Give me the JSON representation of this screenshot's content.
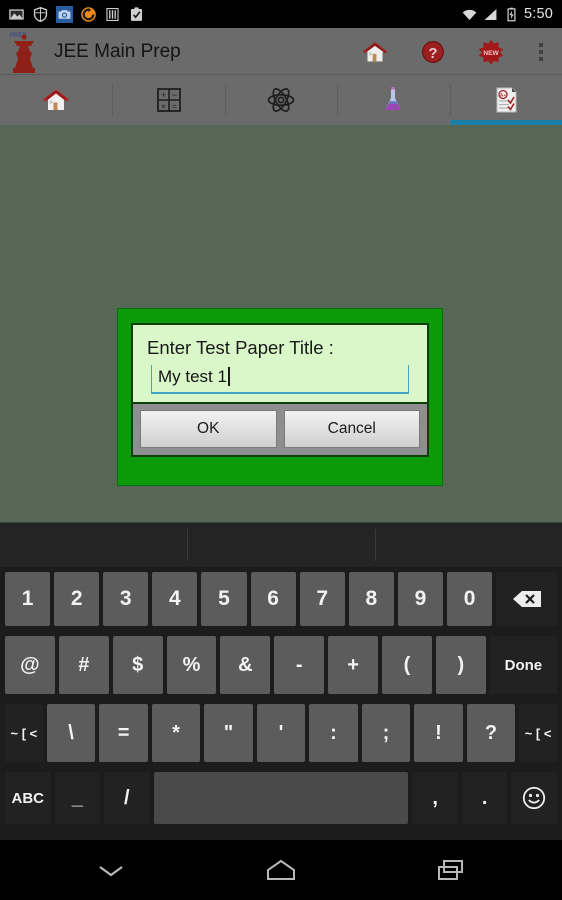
{
  "statusbar": {
    "time": "5:50",
    "left_icons": [
      {
        "name": "screenshot-icon"
      },
      {
        "name": "shield-icon"
      },
      {
        "name": "camera-icon"
      },
      {
        "name": "sync-icon"
      },
      {
        "name": "bars-icon"
      },
      {
        "name": "clipboard-check-icon"
      }
    ],
    "right_icons": [
      {
        "name": "wifi-icon"
      },
      {
        "name": "signal-icon"
      },
      {
        "name": "battery-charging-icon"
      }
    ]
  },
  "appbar": {
    "title": "JEE Main Prep",
    "logo_name": "chess-rook-logo",
    "actions": [
      {
        "name": "home-icon"
      },
      {
        "name": "help-icon"
      },
      {
        "name": "new-badge-icon"
      }
    ],
    "overflow_name": "overflow-menu-icon"
  },
  "tabs": [
    {
      "name": "tab-home",
      "icon": "home-icon",
      "active": false
    },
    {
      "name": "tab-mathematics",
      "icon": "calculator-icon",
      "active": false
    },
    {
      "name": "tab-physics",
      "icon": "atom-icon",
      "active": false
    },
    {
      "name": "tab-chemistry",
      "icon": "flask-icon",
      "active": false
    },
    {
      "name": "tab-test-papers",
      "icon": "test-paper-icon",
      "active": true
    }
  ],
  "dialog": {
    "label": "Enter Test Paper Title :",
    "input_value": "My test 1",
    "ok_label": "OK",
    "cancel_label": "Cancel",
    "border_color": "#0a9a0a",
    "field_bg": "#d9f7c9",
    "underline_color": "#3fa7c4"
  },
  "keyboard": {
    "suggestions": [
      "",
      "",
      ""
    ],
    "rows": [
      {
        "name": "numbers-row",
        "keys": [
          {
            "label": "1",
            "name": "key-1",
            "style": "light"
          },
          {
            "label": "2",
            "name": "key-2",
            "style": "light"
          },
          {
            "label": "3",
            "name": "key-3",
            "style": "light"
          },
          {
            "label": "4",
            "name": "key-4",
            "style": "light"
          },
          {
            "label": "5",
            "name": "key-5",
            "style": "light"
          },
          {
            "label": "6",
            "name": "key-6",
            "style": "light"
          },
          {
            "label": "7",
            "name": "key-7",
            "style": "light"
          },
          {
            "label": "8",
            "name": "key-8",
            "style": "light"
          },
          {
            "label": "9",
            "name": "key-9",
            "style": "light"
          },
          {
            "label": "0",
            "name": "key-0",
            "style": "light"
          },
          {
            "label": "",
            "name": "backspace-key",
            "style": "dark",
            "icon": "backspace-icon"
          }
        ]
      },
      {
        "name": "symbols-row-1",
        "keys": [
          {
            "label": "@",
            "name": "key-at",
            "style": "light"
          },
          {
            "label": "#",
            "name": "key-hash",
            "style": "light"
          },
          {
            "label": "$",
            "name": "key-dollar",
            "style": "light"
          },
          {
            "label": "%",
            "name": "key-percent",
            "style": "light"
          },
          {
            "label": "&",
            "name": "key-ampersand",
            "style": "light"
          },
          {
            "label": "-",
            "name": "key-hyphen",
            "style": "light"
          },
          {
            "label": "+",
            "name": "key-plus",
            "style": "light"
          },
          {
            "label": "(",
            "name": "key-paren-open",
            "style": "light"
          },
          {
            "label": ")",
            "name": "key-paren-close",
            "style": "light"
          },
          {
            "label": "Done",
            "name": "done-key",
            "style": "dark"
          }
        ]
      },
      {
        "name": "symbols-row-2",
        "keys": [
          {
            "label": "~ [ <",
            "name": "alt-symbols-key-left",
            "style": "dark"
          },
          {
            "label": "\\",
            "name": "key-backslash",
            "style": "light"
          },
          {
            "label": "=",
            "name": "key-equals",
            "style": "light"
          },
          {
            "label": "*",
            "name": "key-asterisk",
            "style": "light"
          },
          {
            "label": "\"",
            "name": "key-quote-double",
            "style": "light"
          },
          {
            "label": "'",
            "name": "key-quote-single",
            "style": "light"
          },
          {
            "label": ":",
            "name": "key-colon",
            "style": "light"
          },
          {
            "label": ";",
            "name": "key-semicolon",
            "style": "light"
          },
          {
            "label": "!",
            "name": "key-exclamation",
            "style": "light"
          },
          {
            "label": "?",
            "name": "key-question",
            "style": "light"
          },
          {
            "label": "~ [ <",
            "name": "alt-symbols-key-right",
            "style": "dark"
          }
        ]
      },
      {
        "name": "bottom-row",
        "keys": [
          {
            "label": "ABC",
            "name": "abc-key",
            "style": "dark"
          },
          {
            "label": "_",
            "name": "key-underscore",
            "style": "dark"
          },
          {
            "label": "/",
            "name": "key-slash",
            "style": "dark"
          },
          {
            "label": "",
            "name": "space-key",
            "style": "space"
          },
          {
            "label": ",",
            "name": "key-comma",
            "style": "dark"
          },
          {
            "label": ".",
            "name": "key-period",
            "style": "dark"
          },
          {
            "label": "",
            "name": "emoji-key",
            "style": "dark",
            "icon": "emoji-icon"
          }
        ]
      }
    ]
  },
  "navbar": [
    {
      "name": "nav-back-hide-keyboard",
      "icon": "chevron-down-icon"
    },
    {
      "name": "nav-home",
      "icon": "home-pentagon-icon"
    },
    {
      "name": "nav-recents",
      "icon": "recents-icon"
    }
  ]
}
